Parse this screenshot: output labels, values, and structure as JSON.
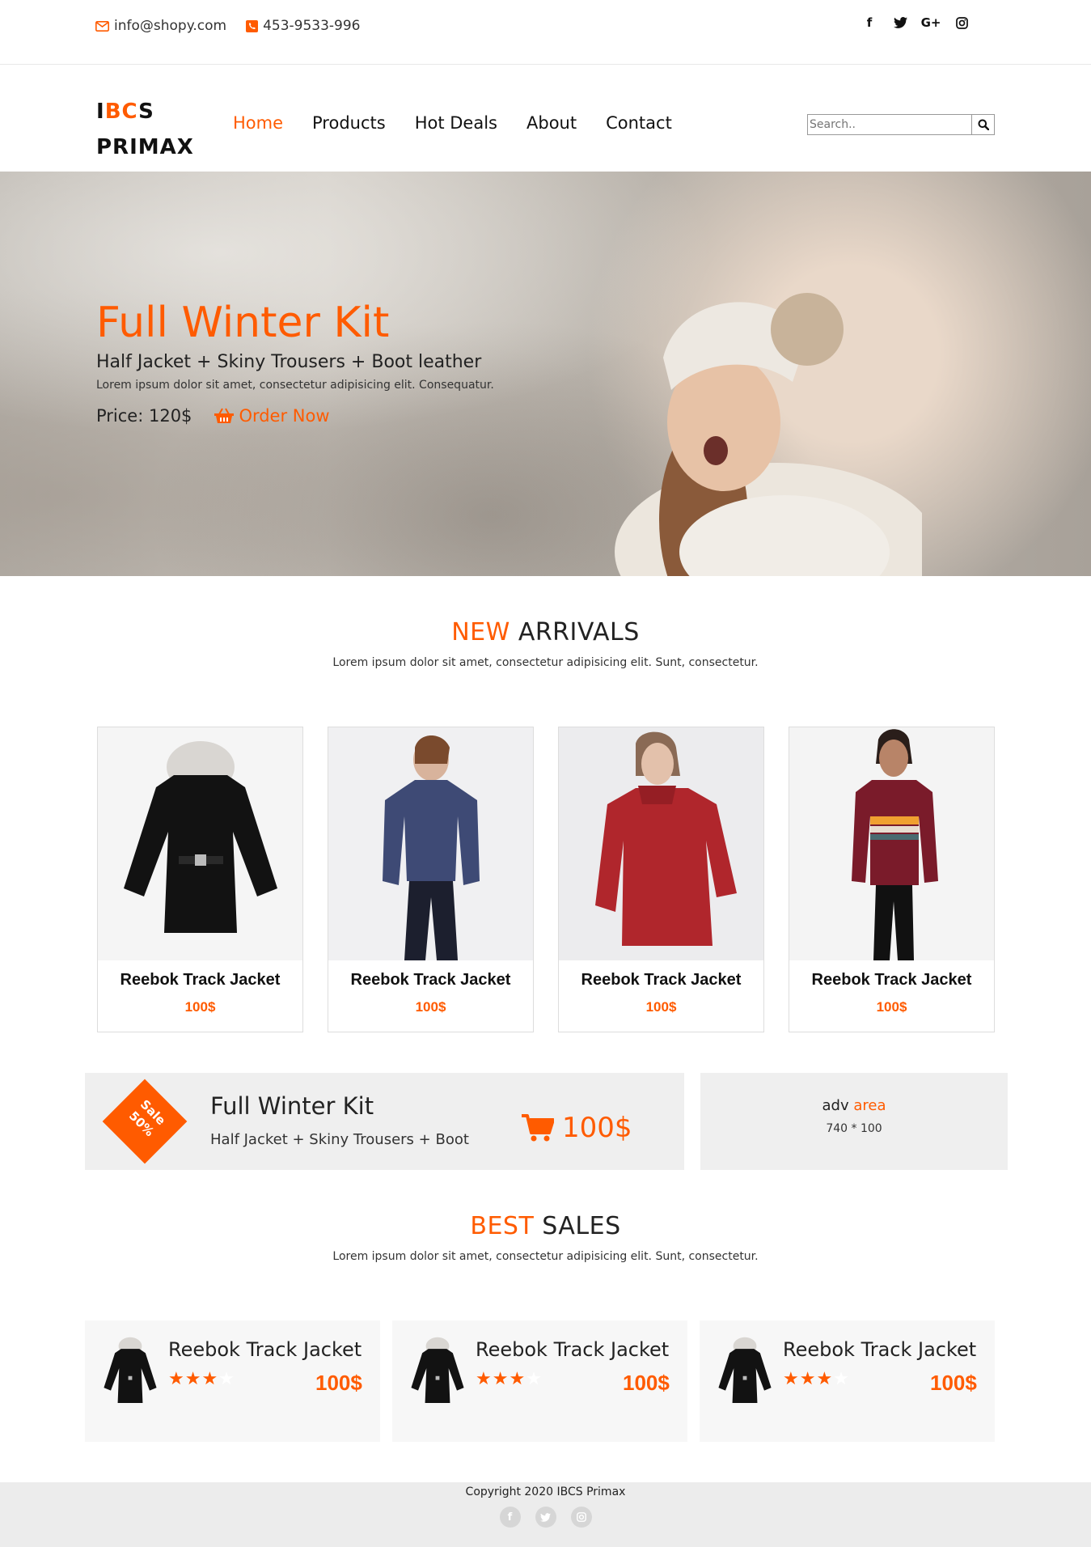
{
  "topbar": {
    "email": "info@shopy.com",
    "phone": "453-9533-996",
    "social": [
      {
        "icon": "facebook-icon",
        "glyph": "f"
      },
      {
        "icon": "twitter-icon",
        "glyph": "t"
      },
      {
        "icon": "google-plus-icon",
        "glyph": "G+"
      },
      {
        "icon": "instagram-icon",
        "glyph": "◎"
      }
    ]
  },
  "header": {
    "logo_line1_a": "I",
    "logo_line1_b": "BC",
    "logo_line1_c": "S",
    "logo_line2": "PRIMAX",
    "nav": [
      "Home",
      "Products",
      "Hot Deals",
      "About",
      "Contact"
    ],
    "search_placeholder": "Search.."
  },
  "hero": {
    "title": "Full Winter Kit",
    "subtitle": "Half Jacket + Skiny Trousers + Boot leather",
    "desc": "Lorem ipsum dolor sit amet, consectetur adipisicing elit. Consequatur.",
    "price": "Price: 120$",
    "order": "Order Now"
  },
  "new_arrivals": {
    "title_a": "NEW",
    "title_b": " ARRIVALS",
    "desc": "Lorem ipsum dolor sit amet, consectetur adipisicing elit. Sunt, consectetur.",
    "items": [
      {
        "name": "Reebok Track Jacket",
        "price": "100$"
      },
      {
        "name": "Reebok Track Jacket",
        "price": "100$"
      },
      {
        "name": "Reebok Track Jacket",
        "price": "100$"
      },
      {
        "name": "Reebok Track Jacket",
        "price": "100$"
      }
    ]
  },
  "promo": {
    "badge_line1": "Sale",
    "badge_line2": "50%",
    "title": "Full Winter Kit",
    "subtitle": "Half Jacket + Skiny Trousers + Boot",
    "price": "100$"
  },
  "adv": {
    "label_a": "adv ",
    "label_b": "area",
    "size": "740 * 100"
  },
  "best_sales": {
    "title_a": "BEST",
    "title_b": " SALES",
    "desc": "Lorem ipsum dolor sit amet, consectetur adipisicing elit. Sunt, consectetur.",
    "items": [
      {
        "name": "Reebok Track Jacket",
        "price": "100$",
        "rating": 3,
        "max": 4
      },
      {
        "name": "Reebok Track Jacket",
        "price": "100$",
        "rating": 3,
        "max": 4
      },
      {
        "name": "Reebok Track Jacket",
        "price": "100$",
        "rating": 3,
        "max": 4
      }
    ]
  },
  "footer": {
    "copyright": "Copyright 2020 IBCS Primax"
  },
  "colors": {
    "accent": "#ff5b00"
  }
}
